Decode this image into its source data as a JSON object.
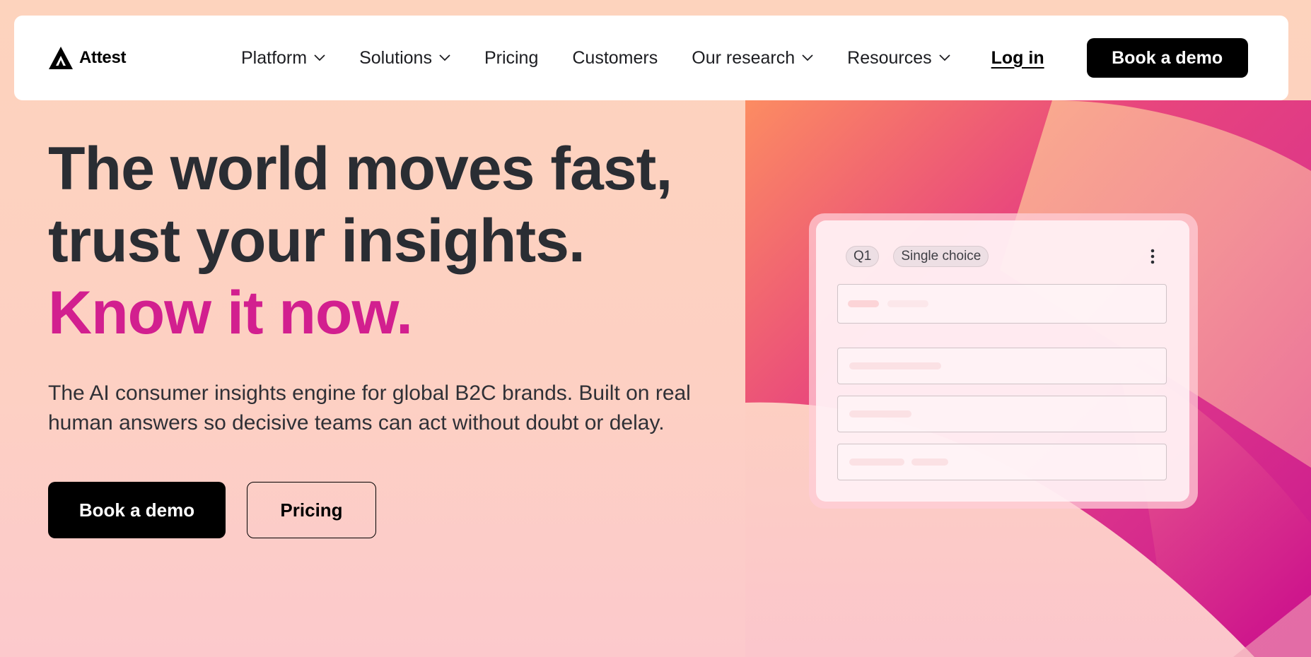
{
  "brand": {
    "name": "Attest",
    "logo_icon": "attest-triangle-logo"
  },
  "nav": {
    "items": [
      {
        "label": "Platform",
        "has_dropdown": true,
        "icon": "chevron-down-icon"
      },
      {
        "label": "Solutions",
        "has_dropdown": true,
        "icon": "chevron-down-icon"
      },
      {
        "label": "Pricing",
        "has_dropdown": false
      },
      {
        "label": "Customers",
        "has_dropdown": false
      },
      {
        "label": "Our research",
        "has_dropdown": true,
        "icon": "chevron-down-icon"
      },
      {
        "label": "Resources",
        "has_dropdown": true,
        "icon": "chevron-down-icon"
      }
    ],
    "login_label": "Log in",
    "cta_label": "Book a demo"
  },
  "hero": {
    "title_line1": "The world moves fast,",
    "title_line2": "trust your insights.",
    "title_accent": "Know it now.",
    "subtitle": "The AI consumer insights engine for global B2C brands. Built on real human answers so decisive teams can act without doubt or delay.",
    "primary_cta": "Book a demo",
    "secondary_cta": "Pricing"
  },
  "question_card": {
    "question_number": "Q1",
    "question_type": "Single choice",
    "menu_icon": "more-vertical-icon"
  },
  "colors": {
    "accent": "#d21f8f",
    "text": "#2a2d33",
    "button_dark": "#000000",
    "background_peach": "#fdd3bd",
    "background_pink": "#fcc9cc",
    "art_magenta": "#d11a8c",
    "art_orange": "#fc8c62"
  }
}
